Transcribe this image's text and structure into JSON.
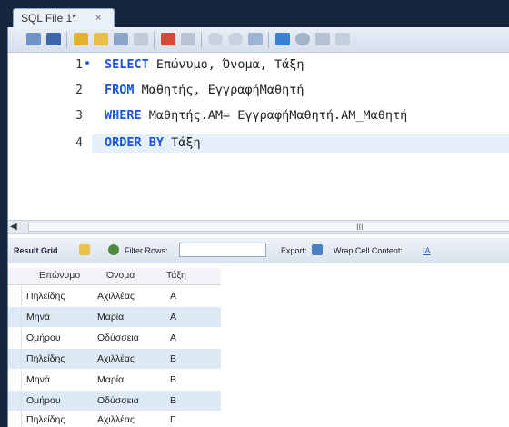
{
  "tab": {
    "title": "SQL File 1*",
    "close": "×"
  },
  "editor": {
    "line_numbers": [
      "1",
      "2",
      "3",
      "4"
    ],
    "lines": [
      {
        "kw": "SELECT",
        "rest": " Επώνυμο, Όνομα, Τάξη"
      },
      {
        "kw": "FROM",
        "rest": " Μαθητής, ΕγγραφήΜαθητή"
      },
      {
        "kw": "WHERE",
        "rest": " Μαθητής.ΑΜ= ΕγγραφήΜαθητή.ΑΜ_Μαθητή"
      },
      {
        "kw": "ORDER BY",
        "rest": " Τάξη"
      }
    ],
    "scroll_grip": "III"
  },
  "result_bar": {
    "result_grid": "Result Grid",
    "filter_rows": "Filter Rows:",
    "export": "Export:",
    "wrap": "Wrap Cell Content:",
    "wrap_icon_text": "IA"
  },
  "table": {
    "columns": [
      "Επώνυμο",
      "Όνομα",
      "Τάξη"
    ],
    "rows": [
      [
        "Πηλείδης",
        "Αχιλλέας",
        "Α"
      ],
      [
        "Μηνά",
        "Μαρία",
        "Α"
      ],
      [
        "Ομήρου",
        "Οδύσσεια",
        "Α"
      ],
      [
        "Πηλείδης",
        "Αχιλλέας",
        "Β"
      ],
      [
        "Μηνά",
        "Μαρία",
        "Β"
      ],
      [
        "Ομήρου",
        "Οδύσσεια",
        "Β"
      ],
      [
        "Πηλείδης",
        "Αχιλλέας",
        "Γ"
      ]
    ]
  },
  "colors": {
    "keyword": "#1a56d6",
    "alt_row": "#dee9f6",
    "frame": "#17263f"
  }
}
